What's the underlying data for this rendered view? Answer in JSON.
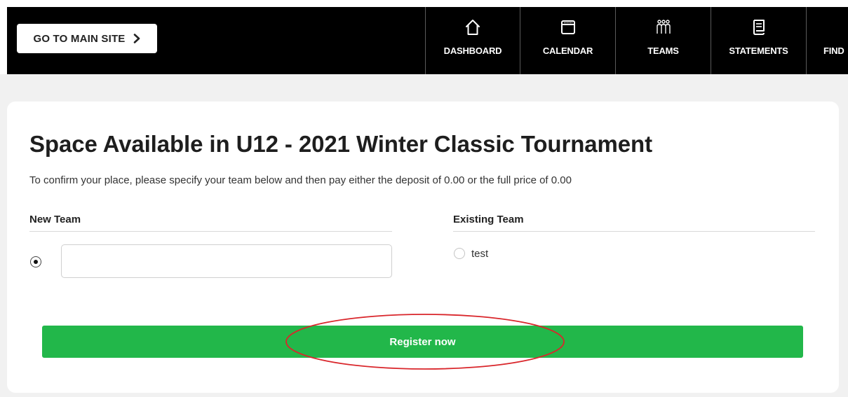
{
  "header": {
    "main_site_label": "GO TO MAIN SITE",
    "nav": [
      {
        "label": "DASHBOARD",
        "icon": "house-icon"
      },
      {
        "label": "CALENDAR",
        "icon": "calendar-icon"
      },
      {
        "label": "TEAMS",
        "icon": "people-icon"
      },
      {
        "label": "STATEMENTS",
        "icon": "document-icon"
      },
      {
        "label": "FIND",
        "icon": "search-icon"
      }
    ]
  },
  "card": {
    "title": "Space Available in U12 - 2021 Winter Classic Tournament",
    "subtitle": "To confirm your place, please specify your team below and then pay either the deposit of 0.00 or the full price of 0.00",
    "new_team": {
      "heading": "New Team",
      "selected": true,
      "input_value": ""
    },
    "existing_team": {
      "heading": "Existing Team",
      "options": [
        {
          "label": "test",
          "selected": false
        }
      ]
    },
    "register_label": "Register now"
  },
  "colors": {
    "topbar": "#000000",
    "page_background": "#f1f1f1",
    "register_button": "#22b74a",
    "annotation_ellipse": "#d9262b"
  }
}
